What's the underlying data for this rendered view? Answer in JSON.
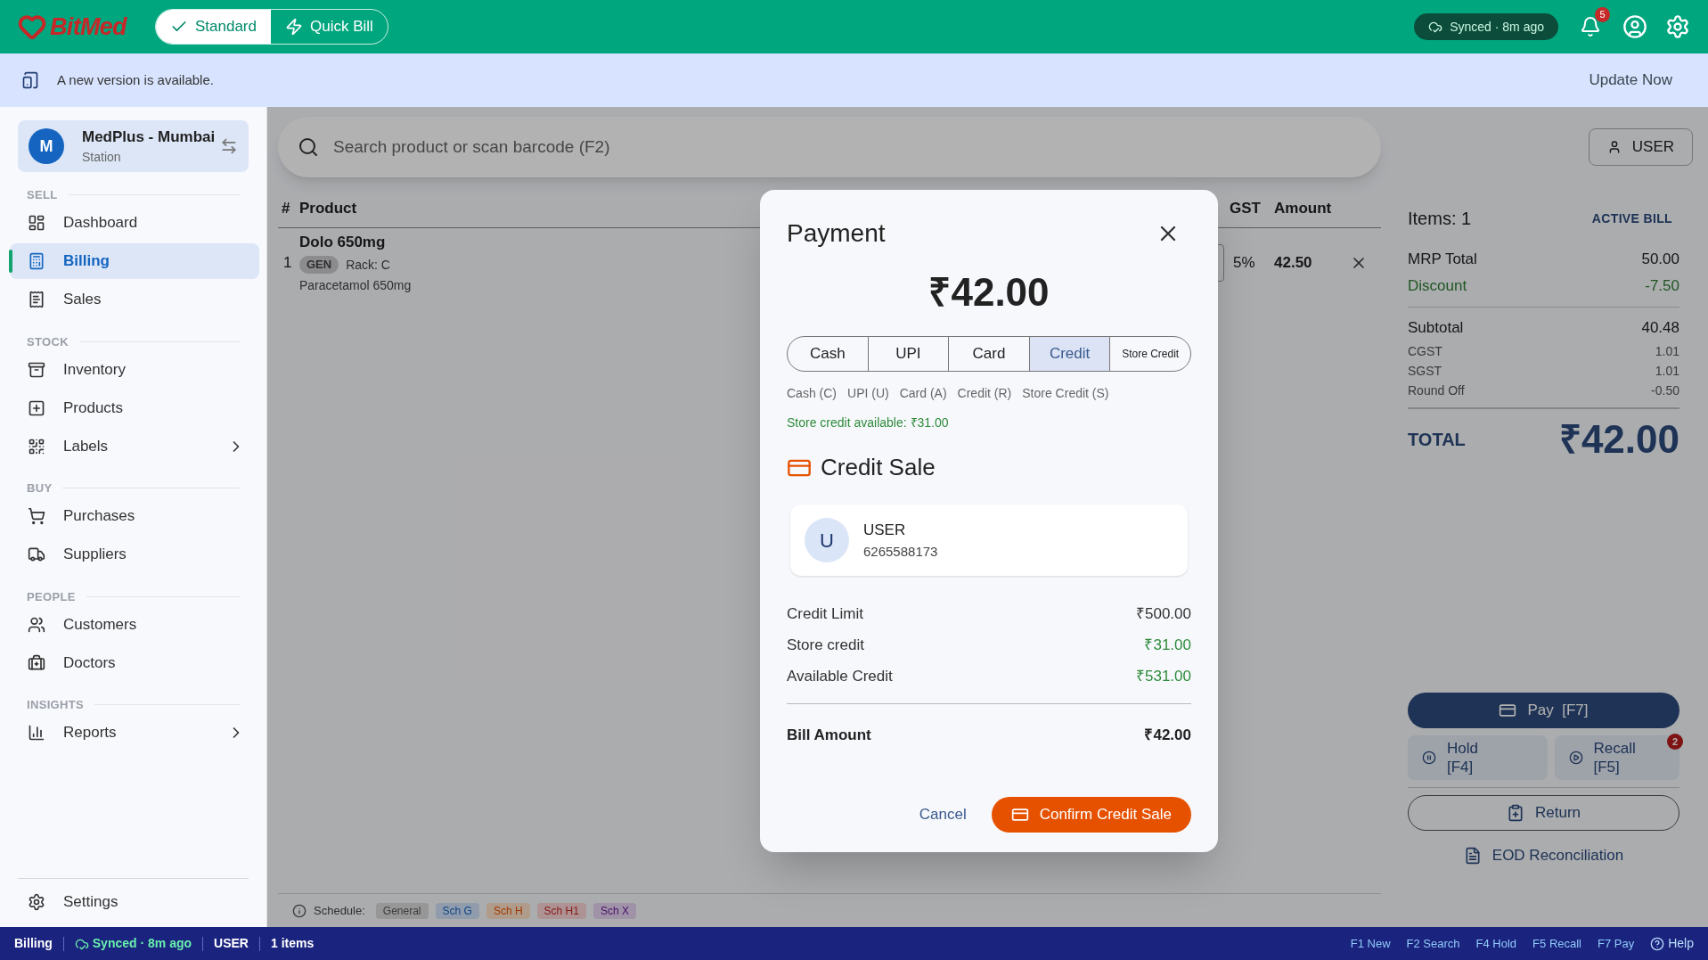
{
  "top_bar": {
    "logo": "BitMed",
    "modes": [
      {
        "label": "Standard",
        "kind": "check",
        "selected": true
      },
      {
        "label": "Quick Bill",
        "kind": "bolt",
        "selected": false
      }
    ],
    "sync_status": "Synced · 8m ago",
    "notification_count": "5"
  },
  "banner": {
    "message": "A new version is available.",
    "action": "Update Now"
  },
  "sidebar": {
    "store": {
      "initial": "M",
      "name": "MedPlus - Mumbai",
      "subtitle": "Station"
    },
    "sections": [
      {
        "title": "SELL",
        "items": [
          {
            "label": "Dashboard",
            "selected": false,
            "expandable": false
          },
          {
            "label": "Billing",
            "selected": true,
            "expandable": false
          },
          {
            "label": "Sales",
            "selected": false,
            "expandable": false
          }
        ]
      },
      {
        "title": "STOCK",
        "items": [
          {
            "label": "Inventory",
            "selected": false,
            "expandable": false
          },
          {
            "label": "Products",
            "selected": false,
            "expandable": false
          },
          {
            "label": "Labels",
            "selected": false,
            "expandable": true
          }
        ]
      },
      {
        "title": "BUY",
        "items": [
          {
            "label": "Purchases",
            "selected": false,
            "expandable": false
          },
          {
            "label": "Suppliers",
            "selected": false,
            "expandable": false
          }
        ]
      },
      {
        "title": "PEOPLE",
        "items": [
          {
            "label": "Customers",
            "selected": false,
            "expandable": false
          },
          {
            "label": "Doctors",
            "selected": false,
            "expandable": false
          }
        ]
      },
      {
        "title": "INSIGHTS",
        "items": [
          {
            "label": "Reports",
            "selected": false,
            "expandable": true
          }
        ]
      }
    ],
    "footer_item": {
      "label": "Settings"
    }
  },
  "search": {
    "placeholder": "Search product or scan barcode (F2)"
  },
  "customer_button": {
    "label": "USER"
  },
  "table": {
    "columns": [
      "#",
      "Product",
      "GST",
      "Amount"
    ],
    "rows": [
      {
        "index": "1",
        "name": "Dolo 650mg",
        "tag": "GEN",
        "rack": "Rack: C",
        "generic": "Paracetamol 650mg",
        "gst": "5%",
        "amount": "42.50"
      }
    ]
  },
  "schedule": {
    "label": "Schedule:",
    "chips": [
      {
        "label": "General",
        "kind": "general"
      },
      {
        "label": "Sch G",
        "kind": "g"
      },
      {
        "label": "Sch H",
        "kind": "h"
      },
      {
        "label": "Sch H1",
        "kind": "h1"
      },
      {
        "label": "Sch X",
        "kind": "x"
      }
    ]
  },
  "bill_panel": {
    "items": "Items: 1",
    "badge": "ACTIVE BILL",
    "lines": [
      {
        "label": "MRP Total",
        "value": "50.00",
        "kind": "main"
      },
      {
        "label": "Discount",
        "value": "-7.50",
        "kind": "discount"
      }
    ],
    "breakdown": [
      {
        "label": "Subtotal",
        "value": "40.48",
        "kind": "main"
      },
      {
        "label": "CGST",
        "value": "1.01",
        "kind": "small"
      },
      {
        "label": "SGST",
        "value": "1.01",
        "kind": "small"
      },
      {
        "label": "Round Off",
        "value": "-0.50",
        "kind": "small"
      }
    ],
    "total_label": "TOTAL",
    "total": "₹42.00",
    "pay": "Pay  [F7]",
    "hold": "Hold [F4]",
    "recall": "Recall [F5]",
    "recall_count": "2",
    "return": "Return",
    "eod": "EOD Reconciliation"
  },
  "payment_dialog": {
    "title": "Payment",
    "amount": "₹42.00",
    "methods": [
      {
        "label": "Cash",
        "selected": false,
        "compact": false
      },
      {
        "label": "UPI",
        "selected": false,
        "compact": false
      },
      {
        "label": "Card",
        "selected": false,
        "compact": false
      },
      {
        "label": "Credit",
        "selected": true,
        "compact": false
      },
      {
        "label": "Store Credit",
        "selected": false,
        "compact": true
      }
    ],
    "shortcuts": [
      "Cash (C)",
      "UPI (U)",
      "Card (A)",
      "Credit (R)",
      "Store Credit (S)"
    ],
    "store_credit_note": "Store credit available: ₹31.00",
    "section_title": "Credit Sale",
    "customer": {
      "initial": "U",
      "name": "USER",
      "phone": "6265588173"
    },
    "details": [
      {
        "label": "Credit Limit",
        "value": "₹500.00",
        "kind": "plain"
      },
      {
        "label": "Store credit",
        "value": "₹31.00",
        "kind": "positive"
      },
      {
        "label": "Available Credit",
        "value": "₹531.00",
        "kind": "positive"
      }
    ],
    "bill_amount": {
      "label": "Bill Amount",
      "value": "₹42.00"
    },
    "cancel": "Cancel",
    "confirm": "Confirm Credit Sale"
  },
  "status_bar": {
    "items": [
      "Billing",
      "Synced · 8m ago",
      "USER",
      "1 items"
    ],
    "shortcuts": [
      "F1 New",
      "F2 Search",
      "F4 Hold",
      "F5 Recall",
      "F7 Pay"
    ],
    "help": "Help"
  }
}
